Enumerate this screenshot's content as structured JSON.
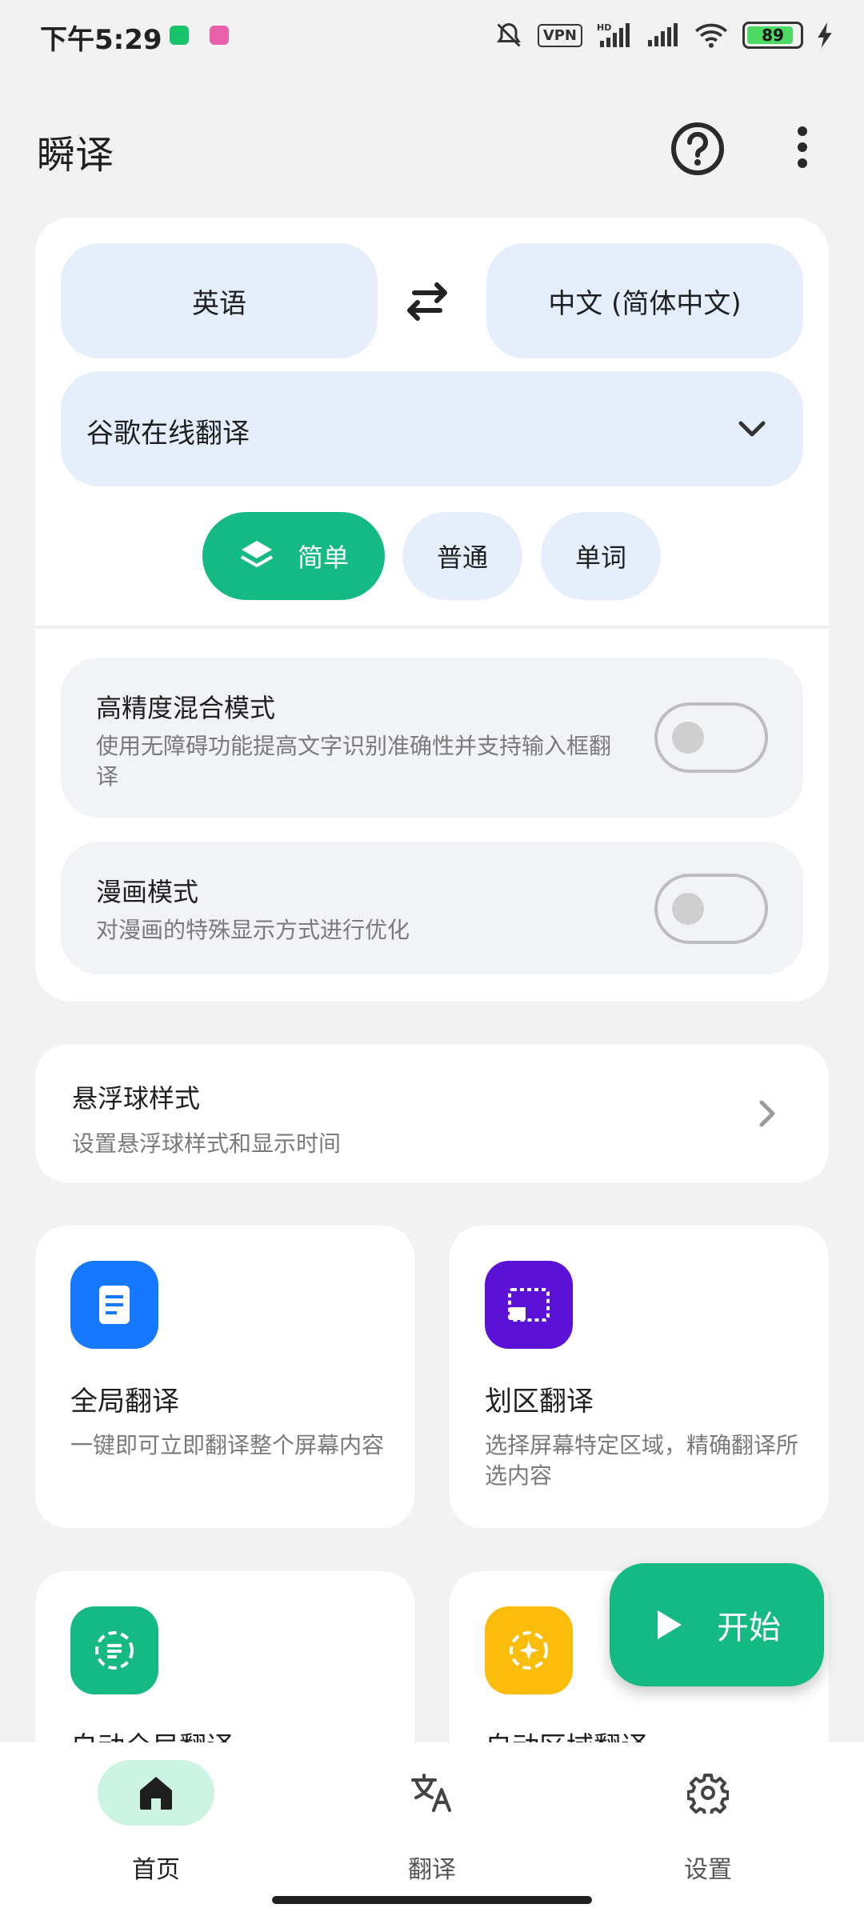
{
  "status_bar": {
    "time": "下午5:29",
    "vpn": "VPN",
    "battery_level": 89,
    "battery_text": "89",
    "network": "HD"
  },
  "app_bar": {
    "title": "瞬译",
    "help_icon": "help-circle-icon",
    "more_icon": "more-vertical-icon"
  },
  "languages": {
    "source": "英语",
    "target": "中文 (简体中文)",
    "swap_icon": "swap-icon"
  },
  "engine": {
    "selected": "谷歌在线翻译"
  },
  "modes": {
    "simple": "简单",
    "normal": "普通",
    "word": "单词",
    "active": "simple"
  },
  "options": [
    {
      "title": "高精度混合模式",
      "description": "使用无障碍功能提高文字识别准确性并支持输入框翻译",
      "enabled": false
    },
    {
      "title": "漫画模式",
      "description": "对漫画的特殊显示方式进行优化",
      "enabled": false
    }
  ],
  "float_ball": {
    "title": "悬浮球样式",
    "description": "设置悬浮球样式和显示时间"
  },
  "features": [
    {
      "title": "全局翻译",
      "description": "一键即可立即翻译整个屏幕内容",
      "icon": "document-icon",
      "color": "#1677ff"
    },
    {
      "title": "划区翻译",
      "description": "选择屏幕特定区域，精确翻译所选内容",
      "icon": "region-select-icon",
      "color": "#5b12d6"
    },
    {
      "title": "自动全局翻译",
      "description": "",
      "icon": "auto-global-icon",
      "color": "#14b983"
    },
    {
      "title": "自动区域翻译",
      "description": "",
      "icon": "auto-region-icon",
      "color": "#fbbd0a"
    }
  ],
  "fab": {
    "label": "开始"
  },
  "bottom_nav": {
    "home": "首页",
    "translate": "翻译",
    "settings": "设置",
    "active": "home"
  },
  "colors": {
    "accent": "#14b983",
    "pill_bg": "#e6eefb",
    "background": "#f2f2f2"
  }
}
